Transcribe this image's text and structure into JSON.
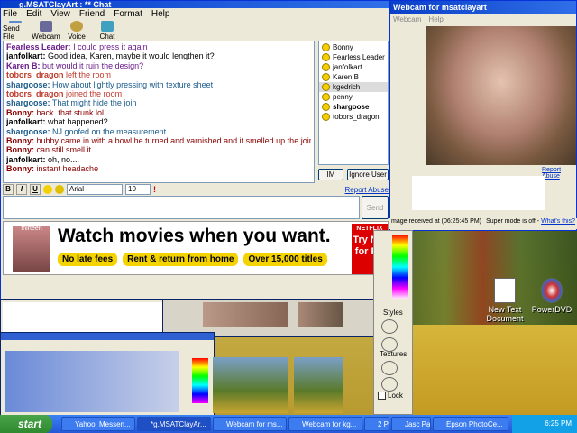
{
  "chat": {
    "title": "g.MSATClayArt : ** Chat",
    "menu": [
      "File",
      "Edit",
      "View",
      "Friend",
      "Format",
      "Help"
    ],
    "toolbar": [
      "Send File",
      "Webcam",
      "Voice",
      "Chat"
    ],
    "messages": [
      {
        "who": "Fearless Leader:",
        "text": "I could press it again",
        "color": "#6a1a8a"
      },
      {
        "who": "janfolkart:",
        "text": "Good idea, Karen, maybe it would lengthen it?",
        "color": "#000000"
      },
      {
        "who": "Karen B:",
        "text": "but would it ruin the design?",
        "color": "#6a1a8a"
      },
      {
        "who": "tobors_dragon",
        "text": "left the room",
        "color": "#c0392b"
      },
      {
        "who": "shargoose:",
        "text": "How about lightly pressing with texture sheet",
        "color": "#1a5a8a"
      },
      {
        "who": "tobors_dragon",
        "text": "joined the room",
        "color": "#c0392b"
      },
      {
        "who": "shargoose:",
        "text": "That might hide the join",
        "color": "#1a5a8a"
      },
      {
        "who": "Bonny:",
        "text": "back..that stunk lol",
        "color": "#8b0000"
      },
      {
        "who": "janfolkart:",
        "text": "what happened?",
        "color": "#000000"
      },
      {
        "who": "shargoose:",
        "text": "NJ goofed on the measurement",
        "color": "#1a5a8a"
      },
      {
        "who": "Bonny:",
        "text": "hubby came in with a bowl he turned and varnished and it smelled up the joint",
        "color": "#8b0000"
      },
      {
        "who": "Bonny:",
        "text": "can still smell it",
        "color": "#8b0000"
      },
      {
        "who": "janfolkart:",
        "text": "oh, no....",
        "color": "#000000"
      },
      {
        "who": "Bonny:",
        "text": "instant headache",
        "color": "#8b0000"
      }
    ],
    "users": [
      "Bonny",
      "Fearless Leader",
      "janfolkart",
      "Karen B",
      "kgedrich",
      "pennyi",
      "shargoose",
      "tobors_dragon"
    ],
    "selected_user": "kgedrich",
    "im_label": "IM",
    "ignore_label": "Ignore User",
    "report_abuse": "Report Abuse",
    "format": {
      "bold": "B",
      "italic": "I",
      "underline": "U",
      "font": "Arial",
      "size": "10"
    },
    "send_label": "Send"
  },
  "ad": {
    "thumb_text": "thirteen",
    "headline": "Watch movies when you want.",
    "pills": [
      "No late fees",
      "Rent & return from home",
      "Over 15,000 titles"
    ],
    "brand": "NETFLIX",
    "cta": "Try Net for FR"
  },
  "webcam": {
    "title": "Webcam for msatclayart",
    "menu": [
      "Webcam",
      "Help"
    ],
    "report_abuse": "Report Abuse",
    "status_left": "mage received at (06:25:45 PM)",
    "status_right": "Super mode is off - ",
    "whats_this": "What's this?"
  },
  "psp_tools": {
    "styles": "Styles",
    "textures": "Textures",
    "lock": "Lock"
  },
  "desktop_icons": [
    "New Text Document",
    "PowerDVD"
  ],
  "taskbar": {
    "start": "start",
    "tasks": [
      "Yahoo! Messen...",
      "*g.MSATClayAr...",
      "Webcam for ms...",
      "Webcam for kg...",
      "2 Paint Sh...",
      "Jasc Paint Shop...",
      "Epson PhotoCe..."
    ],
    "clock": "6:25 PM"
  }
}
